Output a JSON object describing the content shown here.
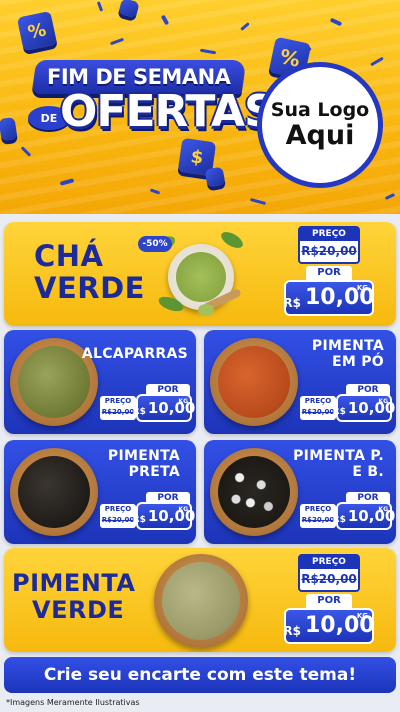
{
  "header": {
    "title_top": "FIM DE SEMANA",
    "title_de": "DE",
    "title_main": "OFERTAS",
    "logo_line1": "Sua Logo",
    "logo_line2": "Aqui"
  },
  "featured_top": {
    "name_line1": "CHÁ",
    "name_line2": "VERDE",
    "discount": "-50%",
    "preco_label": "PREÇO",
    "old_price": "R$20,00",
    "por_label": "POR",
    "currency": "R$",
    "price": "10,00",
    "unit": "KG"
  },
  "products": [
    {
      "name_line1": "ALCAPARRAS",
      "name_line2": "",
      "preco_label": "PREÇO",
      "old_price": "R$20,00",
      "por_label": "POR",
      "currency": "R$",
      "price": "10,00",
      "unit": "KG"
    },
    {
      "name_line1": "PIMENTA",
      "name_line2": "EM PÓ",
      "preco_label": "PREÇO",
      "old_price": "R$20,00",
      "por_label": "POR",
      "currency": "R$",
      "price": "10,00",
      "unit": "KG"
    },
    {
      "name_line1": "PIMENTA",
      "name_line2": "PRETA",
      "preco_label": "PREÇO",
      "old_price": "R$20,00",
      "por_label": "POR",
      "currency": "R$",
      "price": "10,00",
      "unit": "KG"
    },
    {
      "name_line1": "PIMENTA P.",
      "name_line2": "E B.",
      "preco_label": "PREÇO",
      "old_price": "R$20,00",
      "por_label": "POR",
      "currency": "R$",
      "price": "10,00",
      "unit": "KG"
    }
  ],
  "featured_bottom": {
    "name_line1": "PIMENTA",
    "name_line2": "VERDE",
    "preco_label": "PREÇO",
    "old_price": "R$20,00",
    "por_label": "POR",
    "currency": "R$",
    "price": "10,00",
    "unit": "KG"
  },
  "cta": "Crie seu encarte com este tema!",
  "disclaimer": "*Imagens Meramente Ilustrativas",
  "colors": {
    "brand_blue": "#1c34b8",
    "brand_yellow": "#f9b60f"
  },
  "icons": [
    "percent-icon",
    "dollar-icon"
  ]
}
